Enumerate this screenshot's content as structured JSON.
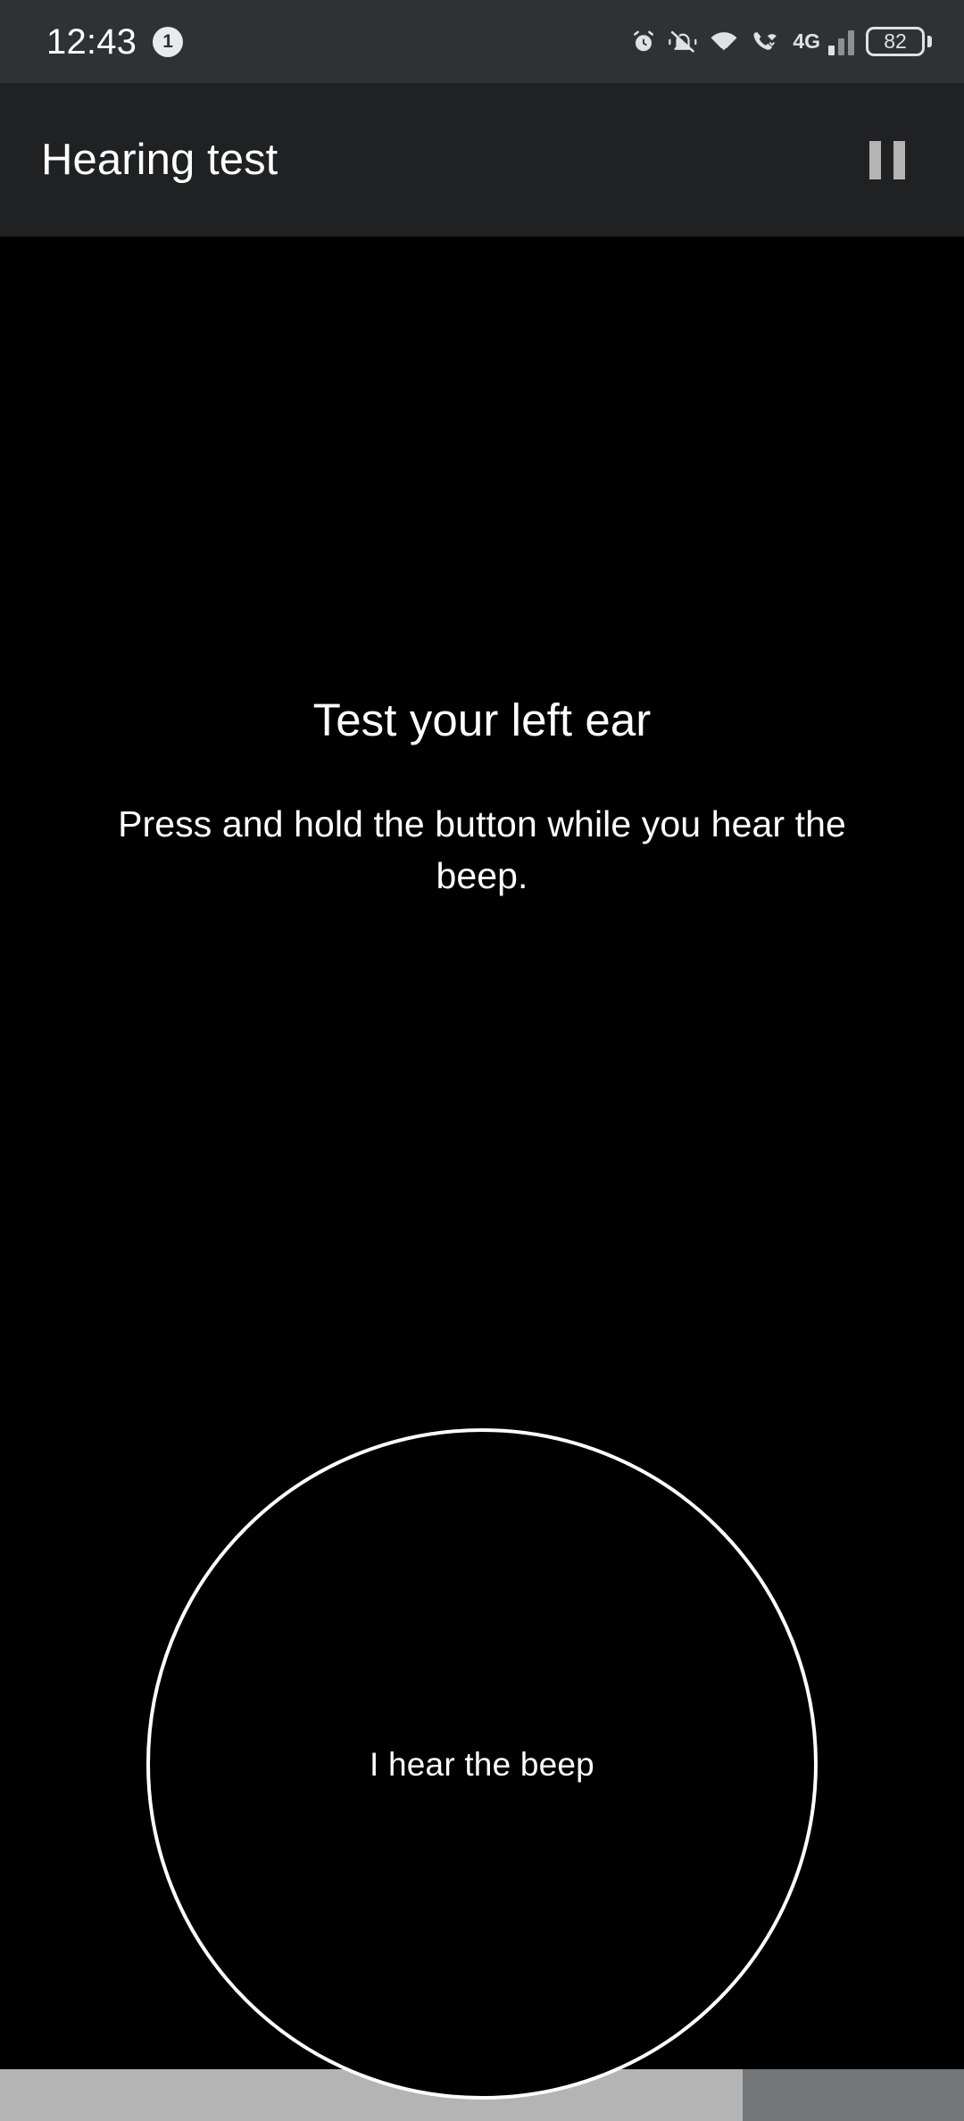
{
  "status_bar": {
    "time": "12:43",
    "notification_count": "1",
    "icons": [
      "alarm-icon",
      "vibrate-off-icon",
      "wifi-icon",
      "wifi-calling-icon",
      "signal-bars-icon",
      "battery-icon"
    ],
    "network_type": "4G",
    "battery_level": "82",
    "background_color": "#2e3235"
  },
  "app_bar": {
    "title": "Hearing test",
    "action_icon": "pause-icon",
    "background_color": "#1f2123"
  },
  "main": {
    "headline": "Test your left ear",
    "instruction": "Press and hold the button while you hear the beep.",
    "button_label": "I hear the beep",
    "background_color": "#000000",
    "accent_color": "#ffffff"
  },
  "progress": {
    "percent": 77,
    "filled_color": "#b4b4b4",
    "track_color": "#73777a"
  }
}
